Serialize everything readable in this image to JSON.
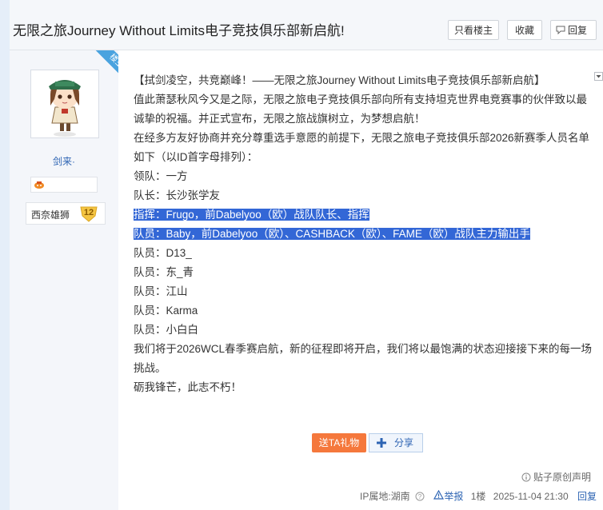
{
  "thread": {
    "title": "无限之旅Journey Without Limits电子竞技俱乐部新启航!",
    "buttons": {
      "only_op": "只看楼主",
      "favorite": "收藏",
      "reply": "回复"
    }
  },
  "author": {
    "badge": "楼主",
    "username": "剑来·",
    "level_name": "西奈雄狮",
    "level_number": "12"
  },
  "post": {
    "lines": [
      "【拭剑凌空，共竞巅峰！——无限之旅Journey Without Limits电子竞技俱乐部新启航】",
      "值此萧瑟秋风今又是之际，无限之旅电子竞技俱乐部向所有支持坦克世界电竞赛事的伙伴致以最诚挚的祝福。并正式宣布，无限之旅战旗树立，为梦想启航！",
      "在经多方友好协商并充分尊重选手意愿的前提下，无限之旅电子竞技俱乐部2026新赛季人员名单如下（以ID首字母排列）：",
      "领队：一方",
      "队长：长沙张学友",
      "指挥：Frugo，前Dabelyoo（欧）战队队长、指挥",
      "队员：Baby，前Dabelyoo（欧）、CASHBACK（欧）、FAME（欧）战队主力输出手",
      "队员：D13_",
      "队员：东_青",
      "队员：江山",
      "队员：Karma",
      "队员：小白白",
      "我们将于2026WCL春季赛启航，新的征程即将开启，我们将以最饱满的状态迎接接下来的每一场挑战。",
      "砺我锋芒，此志不朽！"
    ]
  },
  "actions": {
    "gift": "送TA礼物",
    "share": "分享"
  },
  "footer": {
    "declaration": "贴子原创声明",
    "ip_location": "IP属地:湖南",
    "report": "举报",
    "floor": "1楼",
    "timestamp": "2025-11-04 21:30",
    "reply": "回复"
  },
  "colors": {
    "link": "#2d64b3",
    "selection": "#3367d6",
    "gift_button": "#f5783c",
    "badge": "#4aa3df"
  }
}
